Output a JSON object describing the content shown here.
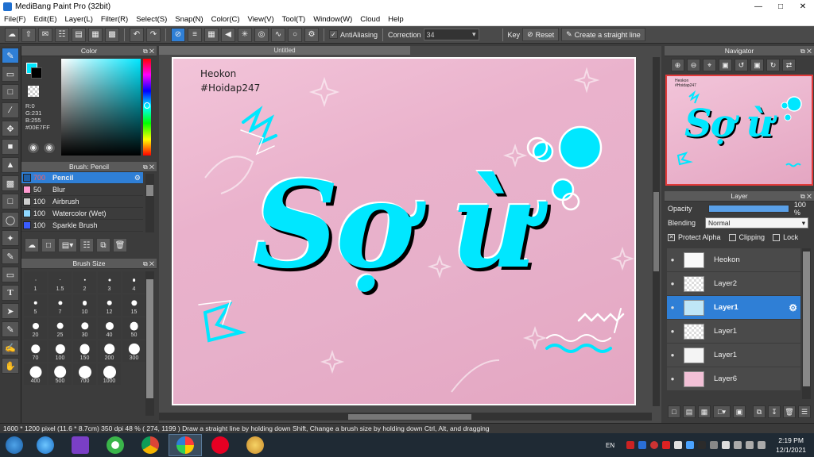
{
  "window": {
    "title": "MediBang Paint Pro (32bit)"
  },
  "menu": [
    "File(F)",
    "Edit(E)",
    "Layer(L)",
    "Filter(R)",
    "Select(S)",
    "Snap(N)",
    "Color(C)",
    "View(V)",
    "Tool(T)",
    "Window(W)",
    "Cloud",
    "Help"
  ],
  "toolbar": {
    "antialias_label": "AntiAliasing",
    "correction_label": "Correction",
    "correction_value": "34",
    "key_label": "Key",
    "reset_label": "Reset",
    "straight_line_label": "Create a straight line"
  },
  "color_panel": {
    "title": "Color",
    "r": "R:0",
    "g": "G:231",
    "b": "B:255",
    "hex": "#00E7FF",
    "current_color": "#00e7ff"
  },
  "brush_panel": {
    "title": "Brush: Pencil",
    "brushes": [
      {
        "size": "700",
        "name": "Pencil",
        "color": "#ffffff",
        "selected": true
      },
      {
        "size": "50",
        "name": "Blur",
        "color": "#ff9ad0"
      },
      {
        "size": "100",
        "name": "Airbrush",
        "color": "#cfcfcf"
      },
      {
        "size": "100",
        "name": "Watercolor (Wet)",
        "color": "#8fd8ff"
      },
      {
        "size": "100",
        "name": "Sparkle Brush",
        "color": "#3a5cff"
      }
    ]
  },
  "size_panel": {
    "title": "Brush Size",
    "sizes": [
      "1",
      "1.5",
      "2",
      "3",
      "4",
      "5",
      "7",
      "10",
      "12",
      "15",
      "20",
      "25",
      "30",
      "40",
      "50",
      "70",
      "100",
      "150",
      "200",
      "300",
      "400",
      "500",
      "700",
      "1000"
    ]
  },
  "document": {
    "tab": "Untitled",
    "signature_name": "Heokon",
    "signature_tag": "#Hoidap247",
    "art_text": "Sợ ừ"
  },
  "navigator": {
    "title": "Navigator"
  },
  "layer_panel": {
    "title": "Layer",
    "opacity_label": "Opacity",
    "opacity_value": "100 %",
    "opacity_fraction": 1.0,
    "blending_label": "Blending",
    "blending_value": "Normal",
    "protect_alpha": "Protect Alpha",
    "clipping": "Clipping",
    "lock": "Lock",
    "layers": [
      {
        "name": "Heokon",
        "thumb": "#fafafa"
      },
      {
        "name": "Layer2",
        "thumb": "#e8e8e8"
      },
      {
        "name": "Layer1",
        "thumb": "#bfe6f7",
        "selected": true
      },
      {
        "name": "Layer1",
        "thumb": "#e8e8e8"
      },
      {
        "name": "Layer1",
        "thumb": "#f4f4f4"
      },
      {
        "name": "Layer6",
        "thumb": "#f2c0d6"
      }
    ]
  },
  "status": {
    "text": "1600 * 1200 pixel   (11.6 * 8.7cm)   350 dpi   48 %   ( 274, 1199 )   Draw a straight line by holding down Shift, Change a brush size by holding down Ctrl, Alt, and dragging"
  },
  "taskbar": {
    "lang": "EN",
    "time": "2:19 PM",
    "date": "12/1/2021"
  }
}
